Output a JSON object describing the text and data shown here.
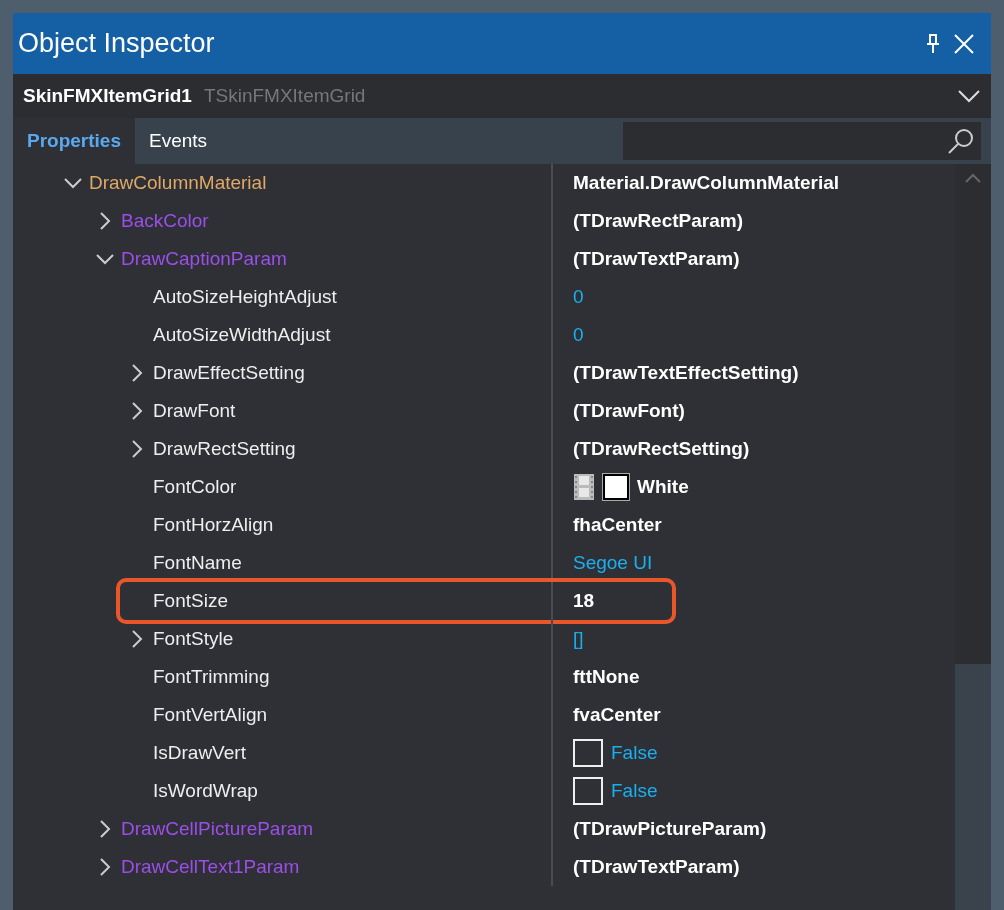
{
  "window": {
    "title": "Object Inspector"
  },
  "component": {
    "name": "SkinFMXItemGrid1",
    "type": "TSkinFMXItemGrid"
  },
  "tabs": [
    {
      "label": "Properties",
      "selected": true
    },
    {
      "label": "Events",
      "selected": false
    }
  ],
  "properties": [
    {
      "name": "DrawColumnMaterial",
      "kind": "category",
      "expanded": true,
      "highlighted": false,
      "value": {
        "kind": "text",
        "text": "Material.DrawColumnMaterial"
      },
      "children": [
        {
          "name": "BackColor",
          "kind": "object",
          "expanded": false,
          "highlighted": false,
          "value": {
            "kind": "text",
            "text": "(TDrawRectParam)"
          }
        },
        {
          "name": "DrawCaptionParam",
          "kind": "object",
          "expanded": true,
          "highlighted": false,
          "value": {
            "kind": "text",
            "text": "(TDrawTextParam)"
          },
          "children": [
            {
              "name": "AutoSizeHeightAdjust",
              "kind": "plain",
              "highlighted": false,
              "value": {
                "kind": "default",
                "text": "0"
              }
            },
            {
              "name": "AutoSizeWidthAdjust",
              "kind": "plain",
              "highlighted": false,
              "value": {
                "kind": "default",
                "text": "0"
              }
            },
            {
              "name": "DrawEffectSetting",
              "kind": "plain",
              "expanded": false,
              "highlighted": false,
              "value": {
                "kind": "text",
                "text": "(TDrawTextEffectSetting)"
              }
            },
            {
              "name": "DrawFont",
              "kind": "plain",
              "expanded": false,
              "highlighted": false,
              "value": {
                "kind": "text",
                "text": "(TDrawFont)"
              }
            },
            {
              "name": "DrawRectSetting",
              "kind": "plain",
              "expanded": false,
              "highlighted": false,
              "value": {
                "kind": "text",
                "text": "(TDrawRectSetting)"
              }
            },
            {
              "name": "FontColor",
              "kind": "plain",
              "highlighted": false,
              "value": {
                "kind": "color",
                "color": "#ffffff",
                "text": "White"
              }
            },
            {
              "name": "FontHorzAlign",
              "kind": "plain",
              "highlighted": false,
              "value": {
                "kind": "text",
                "text": "fhaCenter"
              }
            },
            {
              "name": "FontName",
              "kind": "plain",
              "highlighted": false,
              "value": {
                "kind": "default",
                "text": "Segoe UI"
              }
            },
            {
              "name": "FontSize",
              "kind": "plain",
              "highlighted": true,
              "value": {
                "kind": "text",
                "text": "18"
              }
            },
            {
              "name": "FontStyle",
              "kind": "plain",
              "expanded": false,
              "highlighted": false,
              "value": {
                "kind": "default",
                "text": "[]"
              }
            },
            {
              "name": "FontTrimming",
              "kind": "plain",
              "highlighted": false,
              "value": {
                "kind": "text",
                "text": "fttNone"
              }
            },
            {
              "name": "FontVertAlign",
              "kind": "plain",
              "highlighted": false,
              "value": {
                "kind": "text",
                "text": "fvaCenter"
              }
            },
            {
              "name": "IsDrawVert",
              "kind": "plain",
              "highlighted": false,
              "value": {
                "kind": "checkbox",
                "checked": false,
                "text": "False"
              }
            },
            {
              "name": "IsWordWrap",
              "kind": "plain",
              "highlighted": false,
              "value": {
                "kind": "checkbox",
                "checked": false,
                "text": "False"
              }
            }
          ]
        },
        {
          "name": "DrawCellPictureParam",
          "kind": "object",
          "expanded": false,
          "highlighted": false,
          "value": {
            "kind": "text",
            "text": "(TDrawPictureParam)"
          }
        },
        {
          "name": "DrawCellText1Param",
          "kind": "object",
          "expanded": false,
          "highlighted": false,
          "value": {
            "kind": "text",
            "text": "(TDrawTextParam)"
          }
        }
      ]
    }
  ]
}
